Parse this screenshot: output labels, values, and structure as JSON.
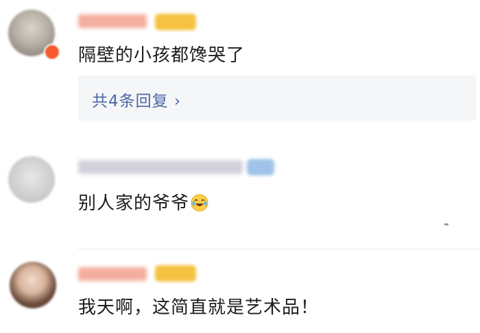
{
  "comments": [
    {
      "text": "隔壁的小孩都馋哭了"
    },
    {
      "text": "别人家的爷爷"
    },
    {
      "text": "我天啊，这简直就是艺术品！"
    }
  ],
  "reply": {
    "label": "共4条回复 ›"
  },
  "icons": {
    "laugh_cry": "laughing-crying-emoji-icon",
    "vip": "vip-badge-icon"
  },
  "colors": {
    "link": "#4a67a6",
    "text": "#1c1c1c",
    "reply_bg": "#f5f6f8",
    "vip": "#f45a2b",
    "badge": "#f5c242"
  }
}
